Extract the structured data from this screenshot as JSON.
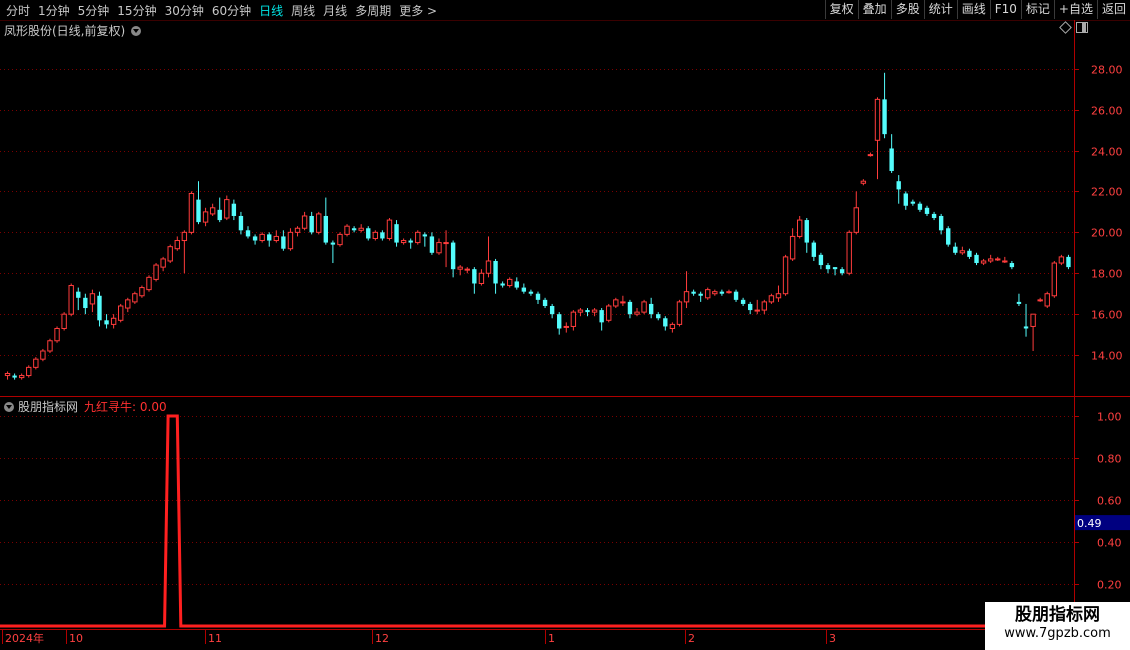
{
  "toolbar": {
    "periods": [
      "分时",
      "1分钟",
      "5分钟",
      "15分钟",
      "30分钟",
      "60分钟",
      "日线",
      "周线",
      "月线",
      "多周期",
      "更多 >"
    ],
    "active_period": "日线",
    "buttons": [
      "复权",
      "叠加",
      "多股",
      "统计",
      "画线",
      "F10",
      "标记",
      "+自选",
      "返回"
    ]
  },
  "main_chart": {
    "title": "凤形股份(日线,前复权)",
    "ylim": [
      12,
      29.5
    ],
    "y_ticks": [
      "28.00",
      "26.00",
      "24.00",
      "22.00",
      "20.00",
      "18.00",
      "16.00",
      "14.00"
    ]
  },
  "indicator": {
    "site_name": "股朋指标网",
    "label": "九红寻牛:",
    "value": "0.00",
    "y_ticks": [
      "1.00",
      "0.80",
      "0.60",
      "0.40",
      "0.20"
    ],
    "cursor_value": "0.49"
  },
  "x_axis": {
    "labels": [
      "2024年",
      "10",
      "11",
      "12",
      "1",
      "2",
      "3"
    ]
  },
  "watermark": {
    "line1": "股朋指标网",
    "line2": "www.7gpzb.com"
  },
  "colors": {
    "up": "#ff3c3c",
    "down": "#54fcfc",
    "grid": "#7a0000",
    "axis": "#b00000",
    "signal": "#ff2020",
    "cursor_box": "#000080"
  },
  "chart_data": {
    "type": "candlestick",
    "ohlc": [
      [
        13.0,
        13.1,
        12.8,
        13.2
      ],
      [
        13.0,
        12.9,
        12.8,
        13.1
      ],
      [
        12.9,
        13.0,
        12.8,
        13.1
      ],
      [
        13.0,
        13.4,
        12.9,
        13.5
      ],
      [
        13.4,
        13.8,
        13.3,
        13.9
      ],
      [
        13.8,
        14.2,
        13.7,
        14.3
      ],
      [
        14.2,
        14.7,
        14.1,
        14.8
      ],
      [
        14.7,
        15.3,
        14.6,
        15.4
      ],
      [
        15.3,
        16.0,
        15.2,
        16.1
      ],
      [
        16.0,
        17.4,
        15.9,
        17.5
      ],
      [
        17.1,
        16.8,
        16.2,
        17.3
      ],
      [
        16.8,
        16.3,
        16.0,
        17.0
      ],
      [
        16.5,
        17.0,
        16.1,
        17.2
      ],
      [
        16.9,
        15.7,
        15.4,
        17.1
      ],
      [
        15.7,
        15.5,
        15.3,
        16.0
      ],
      [
        15.5,
        15.8,
        15.3,
        16.0
      ],
      [
        15.7,
        16.4,
        15.6,
        16.5
      ],
      [
        16.3,
        16.7,
        16.1,
        16.8
      ],
      [
        16.6,
        17.0,
        16.5,
        17.1
      ],
      [
        16.9,
        17.3,
        16.8,
        17.4
      ],
      [
        17.2,
        17.8,
        17.1,
        17.9
      ],
      [
        17.7,
        18.4,
        17.6,
        18.5
      ],
      [
        18.3,
        18.7,
        18.1,
        18.8
      ],
      [
        18.6,
        19.3,
        18.5,
        19.4
      ],
      [
        19.2,
        19.6,
        19.1,
        19.8
      ],
      [
        19.6,
        20.0,
        18.0,
        20.1
      ],
      [
        20.0,
        21.9,
        19.9,
        22.0
      ],
      [
        21.6,
        20.5,
        20.4,
        22.5
      ],
      [
        20.5,
        21.0,
        20.3,
        21.2
      ],
      [
        20.9,
        21.2,
        20.8,
        21.4
      ],
      [
        21.1,
        20.6,
        20.5,
        21.7
      ],
      [
        20.7,
        21.6,
        20.6,
        21.8
      ],
      [
        21.4,
        20.8,
        20.6,
        21.6
      ],
      [
        20.8,
        20.1,
        19.9,
        21.0
      ],
      [
        20.1,
        19.8,
        19.7,
        20.3
      ],
      [
        19.8,
        19.6,
        19.4,
        19.9
      ],
      [
        19.6,
        19.9,
        19.5,
        20.0
      ],
      [
        19.9,
        19.6,
        19.3,
        20.0
      ],
      [
        19.6,
        19.8,
        19.5,
        20.1
      ],
      [
        19.8,
        19.2,
        19.1,
        20.1
      ],
      [
        19.2,
        20.0,
        19.1,
        20.2
      ],
      [
        20.0,
        20.2,
        19.8,
        20.3
      ],
      [
        20.2,
        20.8,
        20.1,
        21.0
      ],
      [
        20.8,
        20.0,
        19.9,
        21.0
      ],
      [
        20.0,
        20.9,
        19.9,
        21.0
      ],
      [
        20.8,
        19.5,
        19.4,
        21.7
      ],
      [
        19.5,
        19.4,
        18.5,
        19.6
      ],
      [
        19.4,
        19.9,
        19.3,
        20.0
      ],
      [
        19.9,
        20.3,
        19.8,
        20.4
      ],
      [
        20.2,
        20.1,
        20.0,
        20.3
      ],
      [
        20.1,
        20.2,
        20.0,
        20.4
      ],
      [
        20.2,
        19.7,
        19.6,
        20.3
      ],
      [
        19.7,
        20.0,
        19.6,
        20.1
      ],
      [
        20.0,
        19.7,
        19.6,
        20.1
      ],
      [
        19.7,
        20.6,
        19.6,
        20.7
      ],
      [
        20.4,
        19.5,
        19.3,
        20.6
      ],
      [
        19.5,
        19.6,
        19.4,
        19.7
      ],
      [
        19.6,
        19.5,
        19.2,
        19.7
      ],
      [
        19.5,
        20.0,
        19.4,
        20.1
      ],
      [
        19.9,
        19.8,
        19.3,
        20.0
      ],
      [
        19.8,
        19.0,
        18.9,
        20.0
      ],
      [
        19.0,
        19.5,
        18.9,
        19.7
      ],
      [
        19.5,
        19.5,
        18.3,
        20.1
      ],
      [
        19.5,
        18.2,
        17.8,
        19.6
      ],
      [
        18.2,
        18.3,
        17.9,
        18.4
      ],
      [
        18.2,
        18.2,
        18.0,
        18.3
      ],
      [
        18.2,
        17.5,
        17.0,
        18.3
      ],
      [
        17.5,
        18.0,
        17.4,
        18.2
      ],
      [
        18.0,
        18.6,
        17.8,
        19.8
      ],
      [
        18.6,
        17.5,
        17.0,
        18.7
      ],
      [
        17.5,
        17.4,
        17.3,
        17.6
      ],
      [
        17.4,
        17.7,
        17.3,
        17.8
      ],
      [
        17.6,
        17.3,
        17.2,
        17.8
      ],
      [
        17.3,
        17.1,
        17.0,
        17.5
      ],
      [
        17.1,
        17.0,
        16.9,
        17.2
      ],
      [
        17.0,
        16.7,
        16.5,
        17.1
      ],
      [
        16.7,
        16.4,
        16.3,
        16.8
      ],
      [
        16.4,
        16.0,
        15.8,
        16.5
      ],
      [
        16.0,
        15.3,
        15.0,
        16.1
      ],
      [
        15.4,
        15.4,
        15.1,
        15.6
      ],
      [
        15.4,
        16.1,
        15.2,
        16.2
      ],
      [
        16.1,
        16.2,
        15.9,
        16.3
      ],
      [
        16.2,
        16.1,
        15.9,
        16.3
      ],
      [
        16.1,
        16.2,
        15.9,
        16.3
      ],
      [
        16.2,
        15.6,
        15.2,
        16.3
      ],
      [
        15.7,
        16.4,
        15.6,
        16.5
      ],
      [
        16.4,
        16.7,
        16.3,
        16.8
      ],
      [
        16.6,
        16.6,
        16.4,
        16.9
      ],
      [
        16.6,
        16.0,
        15.8,
        16.7
      ],
      [
        16.0,
        16.1,
        15.9,
        16.3
      ],
      [
        16.1,
        16.6,
        16.0,
        16.7
      ],
      [
        16.5,
        16.0,
        15.8,
        16.8
      ],
      [
        16.0,
        15.8,
        15.7,
        16.1
      ],
      [
        15.8,
        15.4,
        15.2,
        15.9
      ],
      [
        15.3,
        15.5,
        15.1,
        15.6
      ],
      [
        15.5,
        16.6,
        15.4,
        16.7
      ],
      [
        16.6,
        17.1,
        16.3,
        18.1
      ],
      [
        17.1,
        17.0,
        16.9,
        17.2
      ],
      [
        17.0,
        16.9,
        16.6,
        17.1
      ],
      [
        16.8,
        17.2,
        16.7,
        17.3
      ],
      [
        17.0,
        17.1,
        16.9,
        17.2
      ],
      [
        17.1,
        17.0,
        16.9,
        17.2
      ],
      [
        17.1,
        17.1,
        17.0,
        17.2
      ],
      [
        17.1,
        16.7,
        16.6,
        17.2
      ],
      [
        16.7,
        16.5,
        16.4,
        16.8
      ],
      [
        16.5,
        16.2,
        16.0,
        16.6
      ],
      [
        16.2,
        16.2,
        16.0,
        16.7
      ],
      [
        16.2,
        16.6,
        16.0,
        16.7
      ],
      [
        16.6,
        16.9,
        16.5,
        17.0
      ],
      [
        16.8,
        17.0,
        16.6,
        17.4
      ],
      [
        17.0,
        18.8,
        16.9,
        18.9
      ],
      [
        18.7,
        19.8,
        18.6,
        20.2
      ],
      [
        19.8,
        20.6,
        19.7,
        20.8
      ],
      [
        20.6,
        19.5,
        19.0,
        20.7
      ],
      [
        19.5,
        18.8,
        18.6,
        19.6
      ],
      [
        18.9,
        18.4,
        18.2,
        19.0
      ],
      [
        18.4,
        18.2,
        18.0,
        18.5
      ],
      [
        18.3,
        18.2,
        17.9,
        18.3
      ],
      [
        18.2,
        18.0,
        17.9,
        18.3
      ],
      [
        18.0,
        20.0,
        17.9,
        20.1
      ],
      [
        20.0,
        21.2,
        19.9,
        22.0
      ],
      [
        22.4,
        22.5,
        22.3,
        22.6
      ],
      [
        23.8,
        23.8,
        23.7,
        23.9
      ],
      [
        24.5,
        26.5,
        22.6,
        26.6
      ],
      [
        26.5,
        24.8,
        24.6,
        27.8
      ],
      [
        24.1,
        23.0,
        22.9,
        24.8
      ],
      [
        22.5,
        22.1,
        21.4,
        22.8
      ],
      [
        21.9,
        21.3,
        21.1,
        22.0
      ],
      [
        21.5,
        21.4,
        21.3,
        21.6
      ],
      [
        21.4,
        21.1,
        21.0,
        21.5
      ],
      [
        21.2,
        20.9,
        20.8,
        21.3
      ],
      [
        20.9,
        20.7,
        20.6,
        21.0
      ],
      [
        20.8,
        20.1,
        19.9,
        20.9
      ],
      [
        20.2,
        19.4,
        19.3,
        20.3
      ],
      [
        19.3,
        19.0,
        18.9,
        19.5
      ],
      [
        19.0,
        19.1,
        18.9,
        19.3
      ],
      [
        19.1,
        18.8,
        18.7,
        19.2
      ],
      [
        18.9,
        18.5,
        18.4,
        19.0
      ],
      [
        18.5,
        18.6,
        18.4,
        18.7
      ],
      [
        18.6,
        18.7,
        18.5,
        18.9
      ],
      [
        18.7,
        18.7,
        18.6,
        18.8
      ],
      [
        18.6,
        18.6,
        18.5,
        18.8
      ],
      [
        18.5,
        18.3,
        18.2,
        18.6
      ],
      [
        16.6,
        16.5,
        16.4,
        17.0
      ],
      [
        15.4,
        15.3,
        14.9,
        16.5
      ],
      [
        15.4,
        16.0,
        14.2,
        16.0
      ],
      [
        16.7,
        16.7,
        16.6,
        16.8
      ],
      [
        16.4,
        17.0,
        16.3,
        17.1
      ],
      [
        16.9,
        18.5,
        16.8,
        18.6
      ],
      [
        18.5,
        18.8,
        18.4,
        18.9
      ],
      [
        18.8,
        18.3,
        18.2,
        18.9
      ]
    ],
    "indicator_values": [
      0,
      0,
      0,
      0,
      0,
      0,
      0,
      0,
      0,
      0,
      0,
      0,
      0,
      0,
      0,
      0,
      0,
      0,
      0,
      0,
      0,
      0,
      0,
      0,
      0,
      0,
      0,
      0,
      0,
      0,
      0,
      0,
      0,
      0,
      0,
      0,
      0,
      0,
      0,
      0,
      0,
      0,
      0,
      0,
      0,
      0,
      0,
      0,
      0,
      0,
      0,
      0,
      0,
      0,
      0,
      0,
      0,
      0,
      0,
      0,
      0,
      0,
      0,
      0,
      0,
      0,
      0,
      0,
      0,
      0,
      0,
      0,
      0,
      0,
      0,
      0,
      0,
      0,
      0,
      0,
      0,
      0,
      0,
      0,
      0,
      0,
      0,
      0,
      0,
      0,
      0,
      0,
      0,
      0,
      0,
      0,
      0,
      0,
      0,
      0,
      0,
      0,
      0,
      0,
      0,
      0,
      0,
      0,
      0,
      0,
      0,
      0,
      0,
      0,
      0,
      0,
      0,
      0,
      0,
      0,
      0,
      0,
      0,
      0,
      0,
      0,
      0,
      0,
      0,
      0,
      0,
      0,
      0,
      0,
      0,
      0,
      0,
      0,
      0,
      0,
      0,
      0,
      0,
      0,
      0,
      0,
      0,
      0,
      0,
      0,
      0,
      0,
      0,
      0,
      0
    ],
    "signal": {
      "values": [
        0,
        1,
        1,
        0
      ],
      "range": "2024-10 to 2024-11"
    }
  }
}
